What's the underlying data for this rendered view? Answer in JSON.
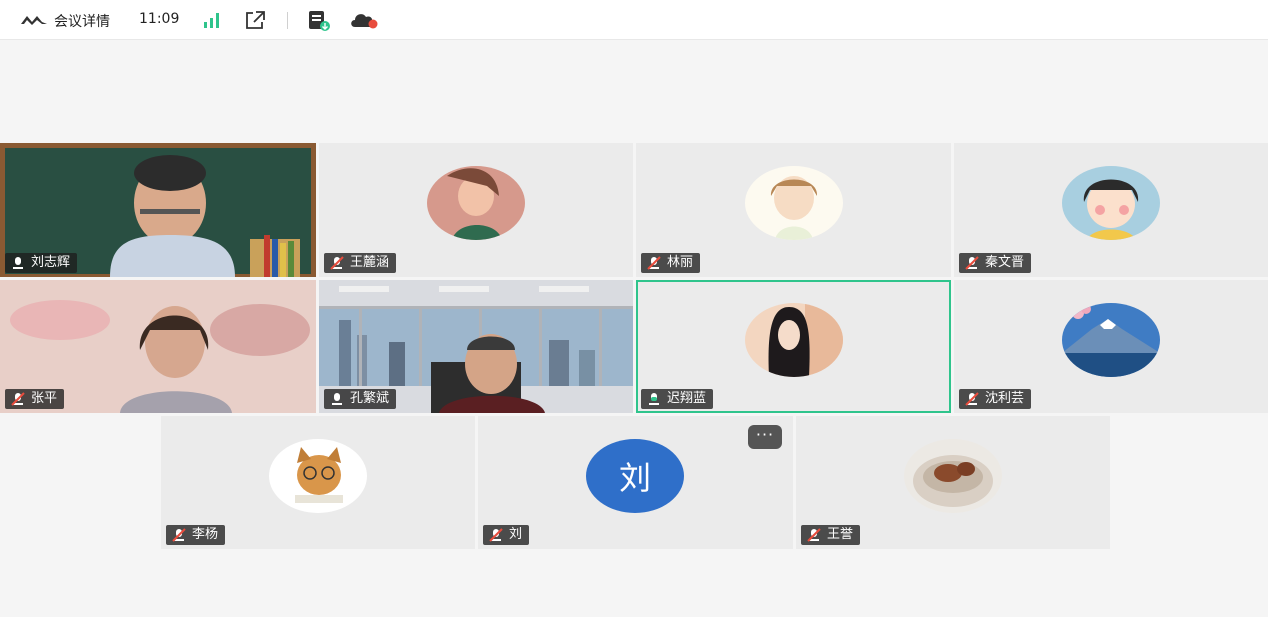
{
  "topbar": {
    "title": "会议详情",
    "time": "11:09",
    "logo_icon": "meeting-logo-icon",
    "signal_icon": "signal-bars-icon",
    "share_icon": "open-external-icon",
    "record_icon": "record-doc-icon",
    "cloud_icon": "cloud-record-icon"
  },
  "participants": [
    {
      "name": "刘志辉",
      "mic": "on",
      "type": "video"
    },
    {
      "name": "王麓涵",
      "mic": "muted",
      "type": "avatar"
    },
    {
      "name": "林丽",
      "mic": "muted",
      "type": "avatar"
    },
    {
      "name": "秦文晋",
      "mic": "muted",
      "type": "avatar"
    },
    {
      "name": "张平",
      "mic": "muted",
      "type": "video"
    },
    {
      "name": "孔繁斌",
      "mic": "on",
      "type": "video"
    },
    {
      "name": "迟翔蓝",
      "mic": "speaking",
      "type": "avatar",
      "active": true
    },
    {
      "name": "沈利芸",
      "mic": "muted",
      "type": "avatar"
    },
    {
      "name": "李杨",
      "mic": "muted",
      "type": "avatar"
    },
    {
      "name": "刘",
      "mic": "muted",
      "type": "initial",
      "initial": "刘"
    },
    {
      "name": "王誉",
      "mic": "muted",
      "type": "avatar"
    }
  ],
  "more_button_label": "···",
  "colors": {
    "active_border": "#2fc48c",
    "initial_avatar_bg": "#2f6fc9",
    "signal": "#2fc48c",
    "cloud_dot": "#e84c3d"
  }
}
